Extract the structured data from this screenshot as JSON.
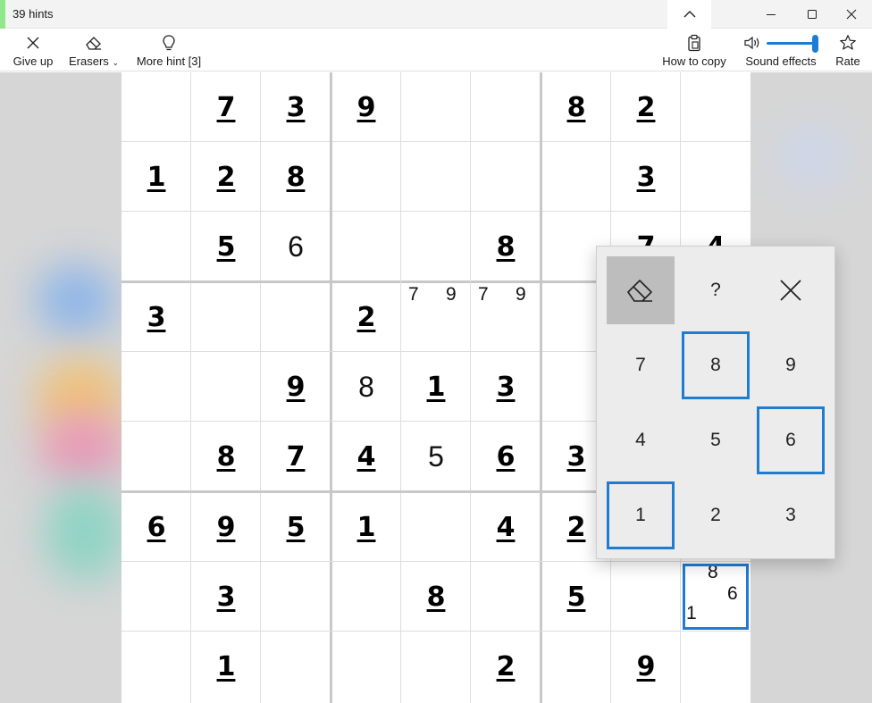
{
  "window": {
    "title": "39 hints",
    "accent_color": "#8fe88a"
  },
  "toolbar": {
    "give_up_label": "Give up",
    "erasers_label": "Erasers",
    "more_hint_label": "More hint [3]",
    "how_to_copy_label": "How to copy",
    "sound_effects_label": "Sound effects",
    "sound_level": 1.0,
    "rate_label": "Rate"
  },
  "board": {
    "selection_color": "#1f7dd1",
    "givens": [
      {
        "r": 0,
        "c": 1,
        "v": "7"
      },
      {
        "r": 0,
        "c": 2,
        "v": "3"
      },
      {
        "r": 0,
        "c": 3,
        "v": "9"
      },
      {
        "r": 0,
        "c": 6,
        "v": "8"
      },
      {
        "r": 0,
        "c": 7,
        "v": "2"
      },
      {
        "r": 1,
        "c": 0,
        "v": "1"
      },
      {
        "r": 1,
        "c": 1,
        "v": "2"
      },
      {
        "r": 1,
        "c": 2,
        "v": "8"
      },
      {
        "r": 1,
        "c": 7,
        "v": "3"
      },
      {
        "r": 2,
        "c": 1,
        "v": "5"
      },
      {
        "r": 2,
        "c": 5,
        "v": "8"
      },
      {
        "r": 2,
        "c": 7,
        "v": "7"
      },
      {
        "r": 2,
        "c": 8,
        "v": "4"
      },
      {
        "r": 3,
        "c": 0,
        "v": "3"
      },
      {
        "r": 3,
        "c": 3,
        "v": "2"
      },
      {
        "r": 4,
        "c": 2,
        "v": "9"
      },
      {
        "r": 4,
        "c": 4,
        "v": "1"
      },
      {
        "r": 4,
        "c": 5,
        "v": "3"
      },
      {
        "r": 5,
        "c": 1,
        "v": "8"
      },
      {
        "r": 5,
        "c": 2,
        "v": "7"
      },
      {
        "r": 5,
        "c": 3,
        "v": "4"
      },
      {
        "r": 5,
        "c": 5,
        "v": "6"
      },
      {
        "r": 5,
        "c": 6,
        "v": "3"
      },
      {
        "r": 6,
        "c": 0,
        "v": "6"
      },
      {
        "r": 6,
        "c": 1,
        "v": "9"
      },
      {
        "r": 6,
        "c": 2,
        "v": "5"
      },
      {
        "r": 6,
        "c": 3,
        "v": "1"
      },
      {
        "r": 6,
        "c": 5,
        "v": "4"
      },
      {
        "r": 6,
        "c": 6,
        "v": "2"
      },
      {
        "r": 7,
        "c": 1,
        "v": "3"
      },
      {
        "r": 7,
        "c": 4,
        "v": "8"
      },
      {
        "r": 7,
        "c": 6,
        "v": "5"
      },
      {
        "r": 8,
        "c": 1,
        "v": "1"
      },
      {
        "r": 8,
        "c": 5,
        "v": "2"
      },
      {
        "r": 8,
        "c": 7,
        "v": "9"
      }
    ],
    "entries": [
      {
        "r": 2,
        "c": 2,
        "v": "6"
      },
      {
        "r": 4,
        "c": 3,
        "v": "8"
      },
      {
        "r": 5,
        "c": 4,
        "v": "5"
      }
    ],
    "notes": [
      {
        "r": 3,
        "c": 4,
        "values": [
          "7",
          "9"
        ]
      },
      {
        "r": 3,
        "c": 5,
        "values": [
          "7",
          "9"
        ]
      },
      {
        "r": 7,
        "c": 8,
        "values": [
          "8",
          "6",
          "1"
        ]
      }
    ],
    "selected": {
      "r": 7,
      "c": 8
    }
  },
  "keypad": {
    "eraser_icon": "eraser-icon",
    "help_label": "?",
    "close_icon": "close-icon",
    "keys": [
      {
        "label": "7",
        "marked": false
      },
      {
        "label": "8",
        "marked": true
      },
      {
        "label": "9",
        "marked": false
      },
      {
        "label": "4",
        "marked": false
      },
      {
        "label": "5",
        "marked": false
      },
      {
        "label": "6",
        "marked": true
      },
      {
        "label": "1",
        "marked": true
      },
      {
        "label": "2",
        "marked": false
      },
      {
        "label": "3",
        "marked": false
      }
    ]
  }
}
